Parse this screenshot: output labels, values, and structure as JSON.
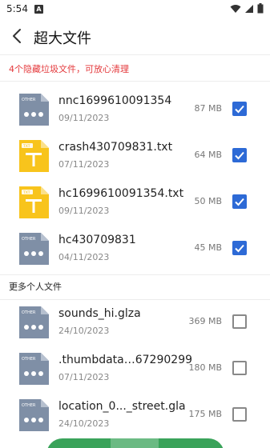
{
  "status_bar": {
    "time": "5:54",
    "app_icon_letter": "A"
  },
  "header": {
    "title": "超大文件"
  },
  "notice": "4个隐藏垃圾文件，可放心清理",
  "section_title": "更多个人文件",
  "colors": {
    "accent": "#2d6ad6",
    "notice": "#e4393c",
    "other_icon": "#7f8fa6",
    "txt_icon": "#f8c41c",
    "button": "#3aa35a"
  },
  "files": [
    {
      "name": "nnc1699610091354",
      "date": "09/11/2023",
      "size": "87 MB",
      "checked": true,
      "type": "OTHER",
      "icon": "other-file-icon"
    },
    {
      "name": "crash430709831.txt",
      "date": "07/11/2023",
      "size": "64 MB",
      "checked": true,
      "type": "TXT",
      "icon": "txt-file-icon"
    },
    {
      "name": "hc1699610091354.txt",
      "date": "09/11/2023",
      "size": "50 MB",
      "checked": true,
      "type": "TXT",
      "icon": "txt-file-icon"
    },
    {
      "name": "hc430709831",
      "date": "04/11/2023",
      "size": "45 MB",
      "checked": true,
      "type": "OTHER",
      "icon": "other-file-icon"
    },
    {
      "name": "sounds_hi.glza",
      "date": "24/10/2023",
      "size": "369 MB",
      "checked": false,
      "type": "OTHER",
      "icon": "other-file-icon"
    },
    {
      "name": ".thumbdata…67290299",
      "date": "07/11/2023",
      "size": "180 MB",
      "checked": false,
      "type": "OTHER",
      "icon": "other-file-icon"
    },
    {
      "name": "location_0..._street.gla",
      "date": "24/10/2023",
      "size": "175 MB",
      "checked": false,
      "type": "OTHER",
      "icon": "other-file-icon"
    }
  ]
}
